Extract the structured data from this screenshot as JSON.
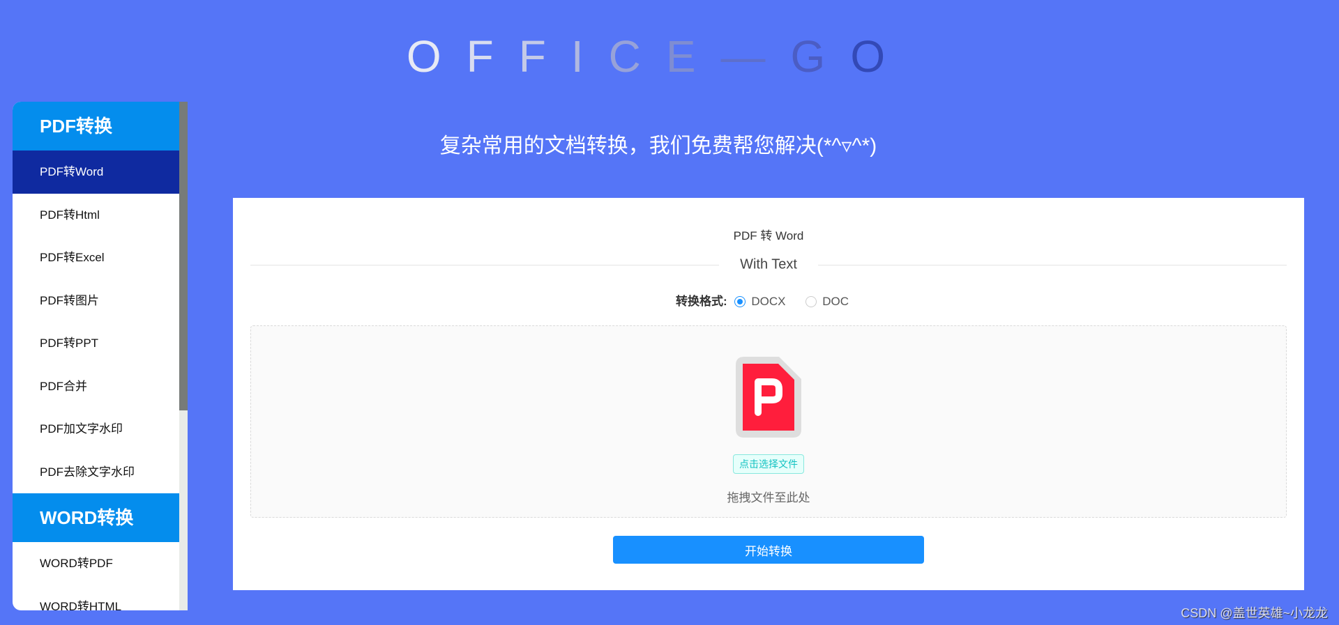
{
  "header": {
    "logo_letters": [
      "O",
      "F",
      "F",
      "I",
      "C",
      "E",
      "—",
      "G",
      "O"
    ],
    "logo_colors": [
      "#e6e9f5",
      "#d8dcf0",
      "#c4cae8",
      "#b0b8e0",
      "#97a2d9",
      "#7f8dd2",
      "#5d6fcc",
      "#4b5dc4",
      "#3349b6"
    ],
    "subtitle": "复杂常用的文档转换，我们免费帮您解决(*^▿^*)"
  },
  "sidebar": {
    "groups": [
      {
        "title": "PDF转换",
        "items": [
          "PDF转Word",
          "PDF转Html",
          "PDF转Excel",
          "PDF转图片",
          "PDF转PPT",
          "PDF合并",
          "PDF加文字水印",
          "PDF去除文字水印"
        ]
      },
      {
        "title": "WORD转换",
        "items": [
          "WORD转PDF",
          "WORD转HTML"
        ]
      }
    ],
    "active": "PDF转Word"
  },
  "panel": {
    "title": "PDF 转 Word",
    "divider_text": "With Text",
    "format_label": "转换格式:",
    "options": [
      "DOCX",
      "DOC"
    ],
    "selected": "DOCX",
    "pick_file": "点击选择文件",
    "drag_hint": "拖拽文件至此处",
    "start_button": "开始转换"
  },
  "watermark": "CSDN @盖世英雄~小龙龙",
  "colors": {
    "background": "#5575f7",
    "accent": "#1890ff",
    "sidebar_header": "#048ded",
    "sidebar_active": "#0f2aa0",
    "pdf_red": "#ff1e3c"
  }
}
